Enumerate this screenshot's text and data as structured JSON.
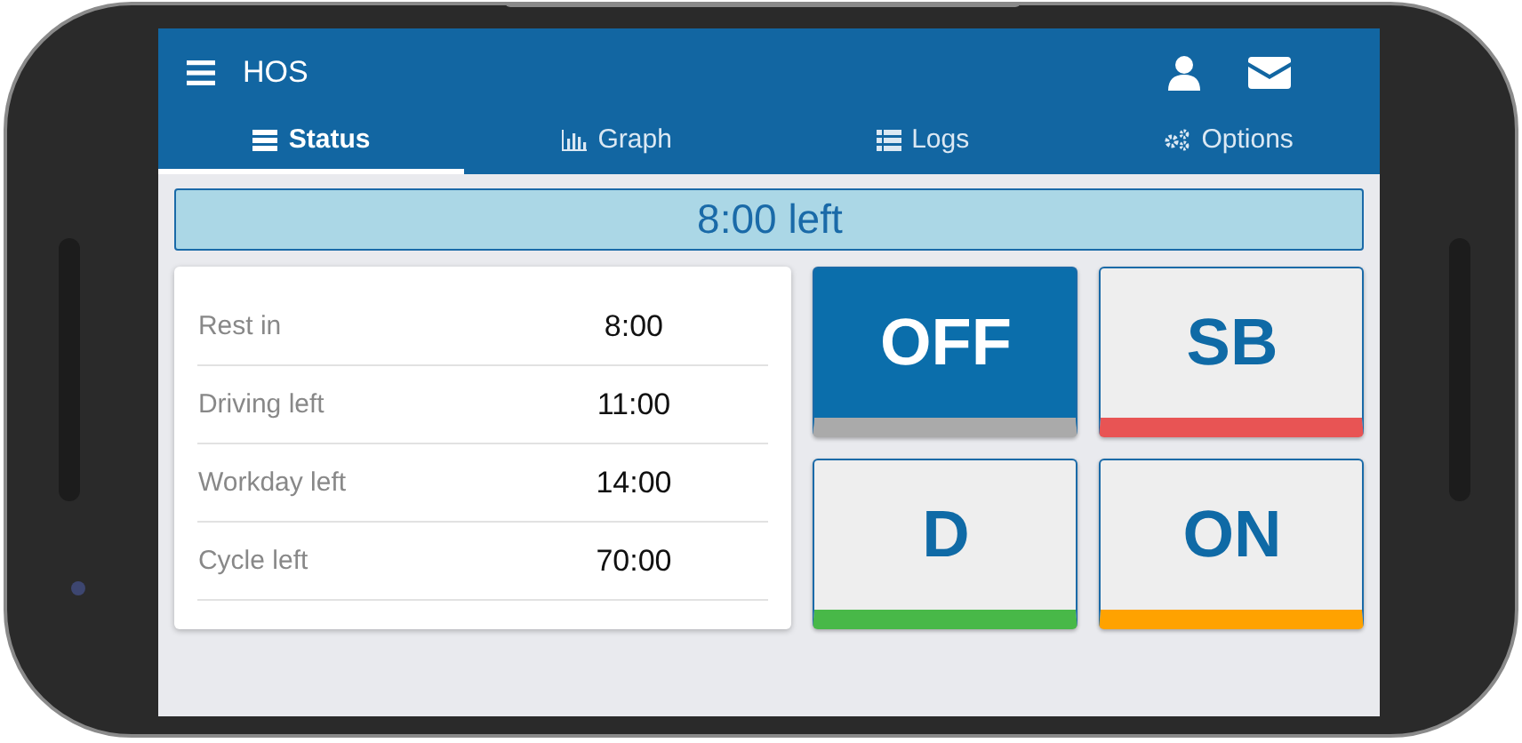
{
  "app_bar": {
    "title": "HOS"
  },
  "tabs": [
    {
      "label": "Status",
      "selected": true
    },
    {
      "label": "Graph",
      "selected": false
    },
    {
      "label": "Logs",
      "selected": false
    },
    {
      "label": "Options",
      "selected": false
    }
  ],
  "banner": "8:00 left",
  "timers": [
    {
      "label": "Rest in",
      "value": "8:00"
    },
    {
      "label": "Driving left",
      "value": "11:00"
    },
    {
      "label": "Workday left",
      "value": "14:00"
    },
    {
      "label": "Cycle left",
      "value": "70:00"
    }
  ],
  "duty_status": [
    {
      "label": "OFF",
      "color": "#aaaaaa",
      "selected": true
    },
    {
      "label": "SB",
      "color": "#e85454",
      "selected": false
    },
    {
      "label": "D",
      "color": "#48b848",
      "selected": false
    },
    {
      "label": "ON",
      "color": "#ffa200",
      "selected": false
    }
  ]
}
